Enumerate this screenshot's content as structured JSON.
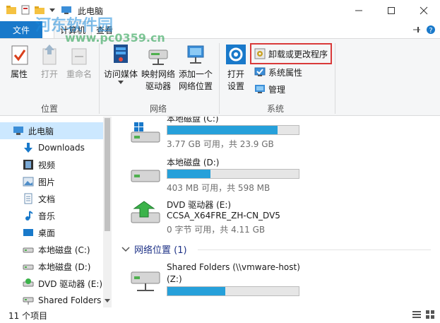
{
  "window": {
    "title": "此电脑",
    "controls": [
      "minimize",
      "maximize",
      "close"
    ]
  },
  "ribbon_tabs": {
    "file": "文件",
    "computer": "计算机",
    "view": "查看"
  },
  "ribbon": {
    "location_group": {
      "label": "位置",
      "properties": "属性",
      "open": "打开",
      "rename": "重命名"
    },
    "network_group": {
      "label": "网络",
      "access_media": "访问媒体",
      "map_drive_line1": "映射网络",
      "map_drive_line2": "驱动器",
      "add_location_line1": "添加一个",
      "add_location_line2": "网络位置"
    },
    "system_group": {
      "label": "系统",
      "open_settings_line1": "打开",
      "open_settings_line2": "设置",
      "uninstall": "卸载或更改程序",
      "system_properties": "系统属性",
      "manage": "管理"
    }
  },
  "nav": {
    "items": [
      {
        "label": "此电脑",
        "icon": "computer-icon",
        "selected": true
      },
      {
        "label": "Downloads",
        "icon": "download-icon"
      },
      {
        "label": "视频",
        "icon": "video-icon"
      },
      {
        "label": "图片",
        "icon": "picture-icon"
      },
      {
        "label": "文档",
        "icon": "document-icon"
      },
      {
        "label": "音乐",
        "icon": "music-icon"
      },
      {
        "label": "桌面",
        "icon": "desktop-icon"
      },
      {
        "label": "本地磁盘 (C:)",
        "icon": "drive-icon"
      },
      {
        "label": "本地磁盘 (D:)",
        "icon": "drive-icon"
      },
      {
        "label": "DVD 驱动器 (E:)",
        "icon": "dvd-icon"
      },
      {
        "label": "Shared Folders",
        "icon": "network-drive-icon"
      }
    ]
  },
  "drives": [
    {
      "name": "本地磁盘 (C:)",
      "info": "3.77 GB 可用，共 23.9 GB",
      "used_fraction": 0.84
    },
    {
      "name": "本地磁盘 (D:)",
      "info": "403 MB 可用，共 598 MB",
      "used_fraction": 0.33
    },
    {
      "name": "DVD 驱动器 (E:)",
      "name2": "CCSA_X64FRE_ZH-CN_DV5",
      "info": "0 字节 可用，共 4.11 GB"
    }
  ],
  "network_section": {
    "header": "网络位置 (1)",
    "items": [
      {
        "name": "Shared Folders (\\\\vmware-host)",
        "name2": "(Z:)",
        "used_fraction": 0.44
      }
    ]
  },
  "status": {
    "count": "11 个项目"
  },
  "watermark": {
    "line1": "河东软件园",
    "line2": "www.pc0359.cn"
  },
  "colors": {
    "accent": "#1979ca",
    "bar_fill": "#26a0da",
    "highlight": "#d93a3a",
    "selection": "#cce8ff"
  }
}
